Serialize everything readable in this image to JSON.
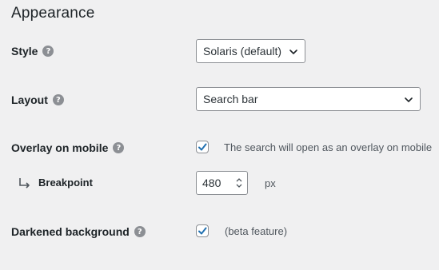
{
  "section": {
    "title": "Appearance"
  },
  "style": {
    "label": "Style",
    "value": "Solaris (default)"
  },
  "layout": {
    "label": "Layout",
    "value": "Search bar"
  },
  "overlay": {
    "label": "Overlay on mobile",
    "checked": true,
    "description": "The search will open as an overlay on mobile"
  },
  "breakpoint": {
    "label": "Breakpoint",
    "value": "480",
    "unit": "px"
  },
  "darkened": {
    "label": "Darkened background",
    "checked": true,
    "description": "(beta feature)"
  },
  "icons": {
    "help": "help-circle-icon",
    "subitem": "subdirectory-arrow-icon",
    "chevron": "chevron-down-icon",
    "check": "check-icon",
    "spinner": "spinner-arrows-icon"
  },
  "colors": {
    "accent": "#2271b1",
    "background": "#f0f0f1",
    "help_icon": "#8c8f94"
  }
}
